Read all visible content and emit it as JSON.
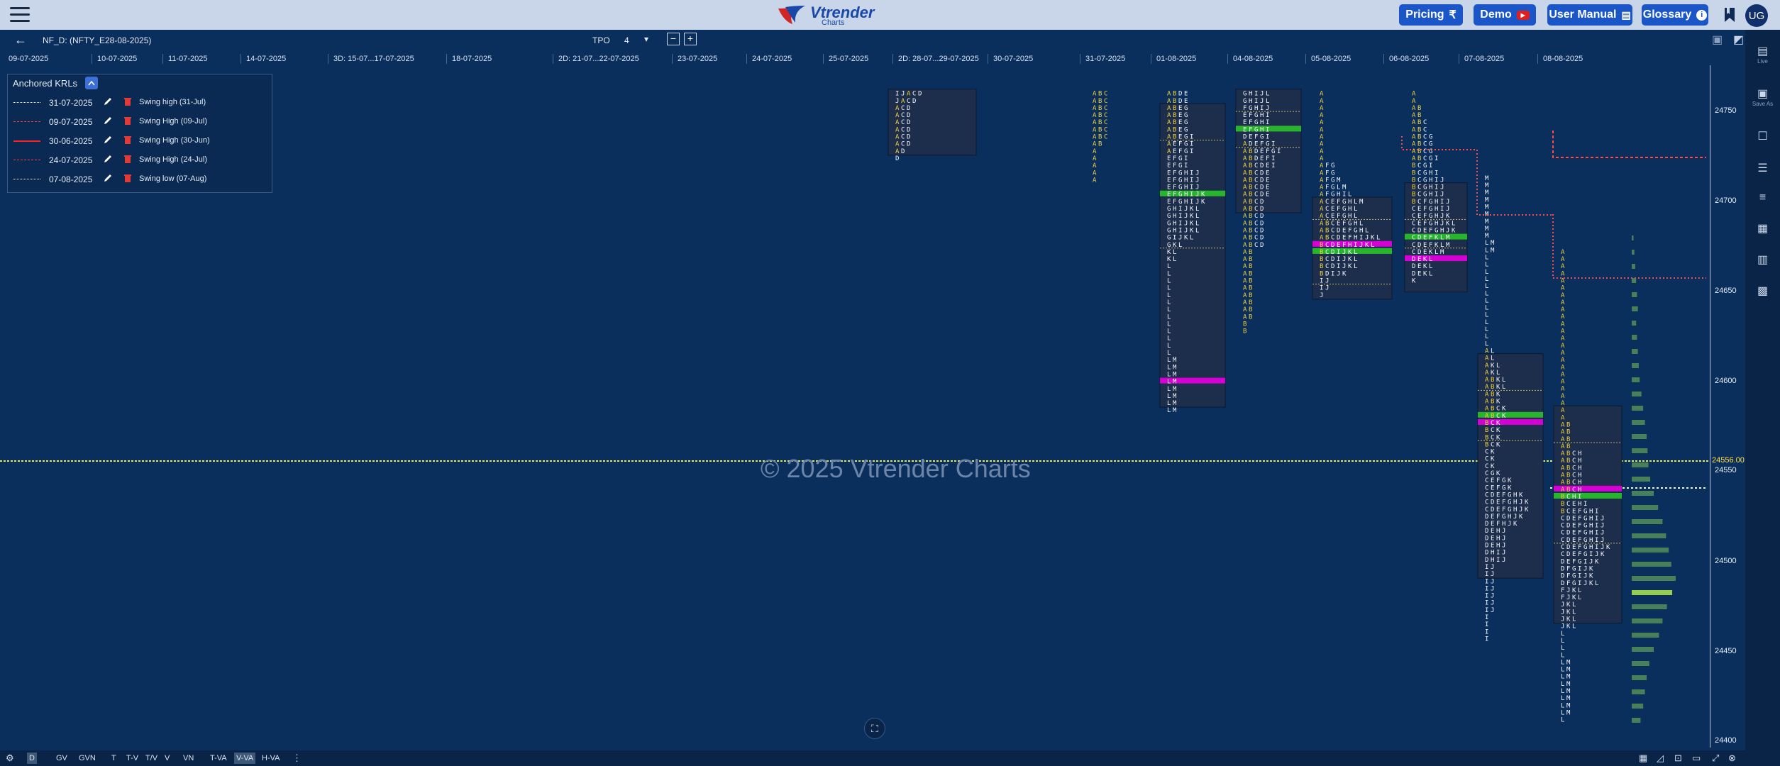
{
  "topbar": {
    "logo_text": "Vtrender",
    "logo_sub": "Charts",
    "buttons": [
      {
        "label": "Pricing",
        "icon": "rupee-icon",
        "symbol": "₹"
      },
      {
        "label": "Demo",
        "icon": "youtube-icon",
        "symbol": "▶"
      },
      {
        "label": "User Manual",
        "icon": "book-icon",
        "symbol": "▤"
      },
      {
        "label": "Glossary",
        "icon": "info-icon",
        "symbol": "i"
      }
    ],
    "avatar": "UG"
  },
  "subbar": {
    "symbol": "NF_D: (NFTY_E28-08-2025)",
    "tpo_label": "TPO",
    "tpo_value": "4",
    "tpo_dropdown": "▾"
  },
  "date_axis": [
    "09-07-2025",
    "10-07-2025",
    "11-07-2025",
    "14-07-2025",
    "3D: 15-07...17-07-2025",
    "18-07-2025",
    "2D: 21-07...22-07-2025",
    "23-07-2025",
    "24-07-2025",
    "25-07-2025",
    "2D: 28-07...29-07-2025",
    "30-07-2025",
    "31-07-2025",
    "01-08-2025",
    "04-08-2025",
    "05-08-2025",
    "06-08-2025",
    "07-08-2025",
    "08-08-2025"
  ],
  "watermark": "© 2025 Vtrender Charts",
  "price_axis": [
    "24750",
    "24700",
    "24650",
    "24600",
    "24550",
    "24500",
    "24450",
    "24400"
  ],
  "last_price": "24556.00",
  "anchored_krls": {
    "title": "Anchored KRLs",
    "items": [
      {
        "date": "31-07-2025",
        "name": "Swing high (31-Jul)",
        "style": "dotted",
        "color": "#ffffff"
      },
      {
        "date": "09-07-2025",
        "name": "Swing High (09-Jul)",
        "style": "dashed",
        "color": "#ff3b3b"
      },
      {
        "date": "30-06-2025",
        "name": "Swing High (30-Jun)",
        "style": "solid",
        "color": "#ff2020"
      },
      {
        "date": "24-07-2025",
        "name": "Swing High (24-Jul)",
        "style": "dashed",
        "color": "#ff3b3b"
      },
      {
        "date": "07-08-2025",
        "name": "Swing low (07-Aug)",
        "style": "dotted",
        "color": "#ffffff"
      }
    ]
  },
  "sidebar": [
    {
      "glyph": "▤",
      "caption": "Live",
      "icon": "live-icon"
    },
    {
      "glyph": "▣",
      "caption": "Save As",
      "icon": "save-as-icon"
    },
    {
      "glyph": "☐",
      "caption": "",
      "icon": "window-icon"
    },
    {
      "glyph": "☰",
      "caption": "",
      "icon": "list-icon"
    },
    {
      "glyph": "≡",
      "caption": "",
      "icon": "menu-icon"
    },
    {
      "glyph": "▦",
      "caption": "",
      "icon": "grid-icon"
    },
    {
      "glyph": "▥",
      "caption": "",
      "icon": "columns-icon"
    },
    {
      "glyph": "▩",
      "caption": "",
      "icon": "tiles-icon"
    }
  ],
  "bottom_bar": {
    "left_buttons": [
      "D",
      "GV",
      "GVN",
      "T",
      "T-V",
      "T/V",
      "V",
      "VN",
      "T-VA",
      "V-VA",
      "H-VA"
    ],
    "active": [
      "D",
      "V-VA"
    ],
    "right_icons": [
      "table-icon",
      "line-chart-icon",
      "camera-icon",
      "layout-icon",
      "expand-icon",
      "close-icon"
    ]
  },
  "colors": {
    "background": "#0b2f5c",
    "topbar": "#c9d6ea",
    "button": "#1a56c7",
    "poc": "#d400d4",
    "value_area": "#27b52b",
    "tpo_yellow": "#f2d03a",
    "tpo_white": "#f4f6fa"
  },
  "chart_data": [
    {
      "session": "2D: 28-07...29-07-2025",
      "tpo_rows": [
        "I J A C D",
        "J A C D",
        "A C D",
        "A C D",
        "A C D",
        "A C D",
        "A C D",
        "A C D",
        "A D",
        "D"
      ]
    },
    {
      "session": "31-07-2025",
      "tpo_rows": [
        "A B C",
        "A B C",
        "A B C",
        "A B C",
        "A B C",
        "A B C",
        "A B C",
        "A B",
        "A",
        "A",
        "A",
        "A",
        "A"
      ]
    },
    {
      "session": "01-08-2025",
      "tpo_rows": [
        "A B D E",
        "A B D E",
        "A B E G",
        "A B E G",
        "A B E G",
        "A B E G",
        "A B E G I",
        "A E F G I",
        "A E F G I",
        "E F G I",
        "E F G I",
        "E F G H I J",
        "E F G H I J",
        "E F G H I J",
        "E F G H I J K",
        "E F G H I J K",
        "G H I J K L",
        "G H I J K L",
        "G H I J K L",
        "G H I J K L",
        "G I J K L",
        "G K L",
        "K L",
        "K L",
        "L",
        "L",
        "L",
        "L",
        "L",
        "L",
        "L",
        "L",
        "L",
        "L",
        "L",
        "L",
        "L",
        "L M",
        "L M",
        "L M",
        "L M",
        "L M",
        "L M",
        "L M",
        "L M"
      ]
    },
    {
      "session": "04-08-2025",
      "tpo_rows": [
        "G H I J L",
        "G H I J L",
        "F G H I J",
        "E F G H I",
        "E F G H I",
        "E F G H I",
        "D E F G I",
        "A D E F G I",
        "A B D E F G I",
        "A B D E F I",
        "A B C D E I",
        "A B C D E",
        "A B C D E",
        "A B C D E",
        "A B C D E",
        "A B C D",
        "A B C D",
        "A B C D",
        "A B C D",
        "A B C D",
        "A B C D",
        "A B C D",
        "A B",
        "A B",
        "A B",
        "A B",
        "A B",
        "A B",
        "A B",
        "A B",
        "A B",
        "A B",
        "B",
        "B"
      ]
    },
    {
      "session": "05-08-2025",
      "tpo_rows": [
        "A",
        "A",
        "A",
        "A",
        "A",
        "A",
        "A",
        "A",
        "A",
        "A",
        "A F G",
        "A F G",
        "A F G M",
        "A F G L M",
        "A F G H I L",
        "A C E F G H L M",
        "A C E F G H L",
        "A C E F G H L",
        "A B C E F G H L",
        "A B C D E F G H L",
        "A B C D E F H I J K L",
        "B C D E F H I J K L",
        "B C D I J K L",
        "B C D I J K L",
        "B C D I J K L",
        "B D I J K",
        "I J",
        "I J",
        "J"
      ]
    },
    {
      "session": "06-08-2025",
      "tpo_rows": [
        "A",
        "A",
        "A B",
        "A B",
        "A B C",
        "A B C",
        "A B C G",
        "A B C G",
        "A B C G",
        "A B C G I",
        "B C G I",
        "B C G H I",
        "B C G H I J",
        "B C G H I J",
        "B C G H I J",
        "B C F G H I J",
        "C E F G H I J",
        "C E F G H J K",
        "C E F G H J K L",
        "C D E F G H J K",
        "C D E F K L M",
        "C D E F K L M",
        "C D E K L M",
        "D E K L",
        "D E K L",
        "D E K L",
        "K"
      ]
    },
    {
      "session": "07-08-2025",
      "tpo_rows": [
        "M",
        "M",
        "M",
        "M",
        "M",
        "M",
        "M",
        "M",
        "M",
        "L M",
        "L M",
        "L",
        "L",
        "L",
        "L",
        "L",
        "L",
        "L",
        "L",
        "L",
        "L",
        "L",
        "L",
        "L",
        "A L",
        "A L",
        "A K L",
        "A K L",
        "A B K L",
        "A B K L",
        "A B K",
        "A B K",
        "A B C K",
        "A B C K",
        "B C K",
        "B C K",
        "B C K",
        "B C K",
        "C K",
        "C K",
        "C K",
        "C G K",
        "C E F G K",
        "C E F G K",
        "C D E F G H K",
        "C D E F G H J K",
        "C D E F G H J K",
        "D E F G H J K",
        "D E F H J K",
        "D E H J",
        "D E H J",
        "D E H J",
        "D H I J",
        "D H I J",
        "I J",
        "I J",
        "I J",
        "I J",
        "I J",
        "I J",
        "I J",
        "I",
        "I",
        "I",
        "I"
      ]
    },
    {
      "session": "08-08-2025",
      "tpo_rows": [
        "A",
        "A",
        "A",
        "A",
        "A",
        "A",
        "A",
        "A",
        "A",
        "A",
        "A",
        "A",
        "A",
        "A",
        "A",
        "A",
        "A",
        "A",
        "A",
        "A",
        "A",
        "A",
        "A",
        "A",
        "A B",
        "A B",
        "A B",
        "A B",
        "A B C H",
        "A B C H",
        "A B C H",
        "A B C H",
        "A B C H",
        "A B C H",
        "B C H I",
        "B C E H I",
        "B C E F G H I",
        "C D E F G H I J",
        "C D E F G H I J",
        "C D E F G H I J",
        "C D E F G H I J",
        "C D E F G H I J K",
        "C D E F G I J K",
        "D E F G I J K",
        "D F G I J K",
        "D F G I J K",
        "D F G I J K L",
        "F J K L",
        "F J K L",
        "J K L",
        "J K L",
        "J K L",
        "J K L",
        "L",
        "L",
        "L",
        "L",
        "L M",
        "L M",
        "L M",
        "L M",
        "L M",
        "L M",
        "L M",
        "L M",
        "L"
      ]
    }
  ]
}
